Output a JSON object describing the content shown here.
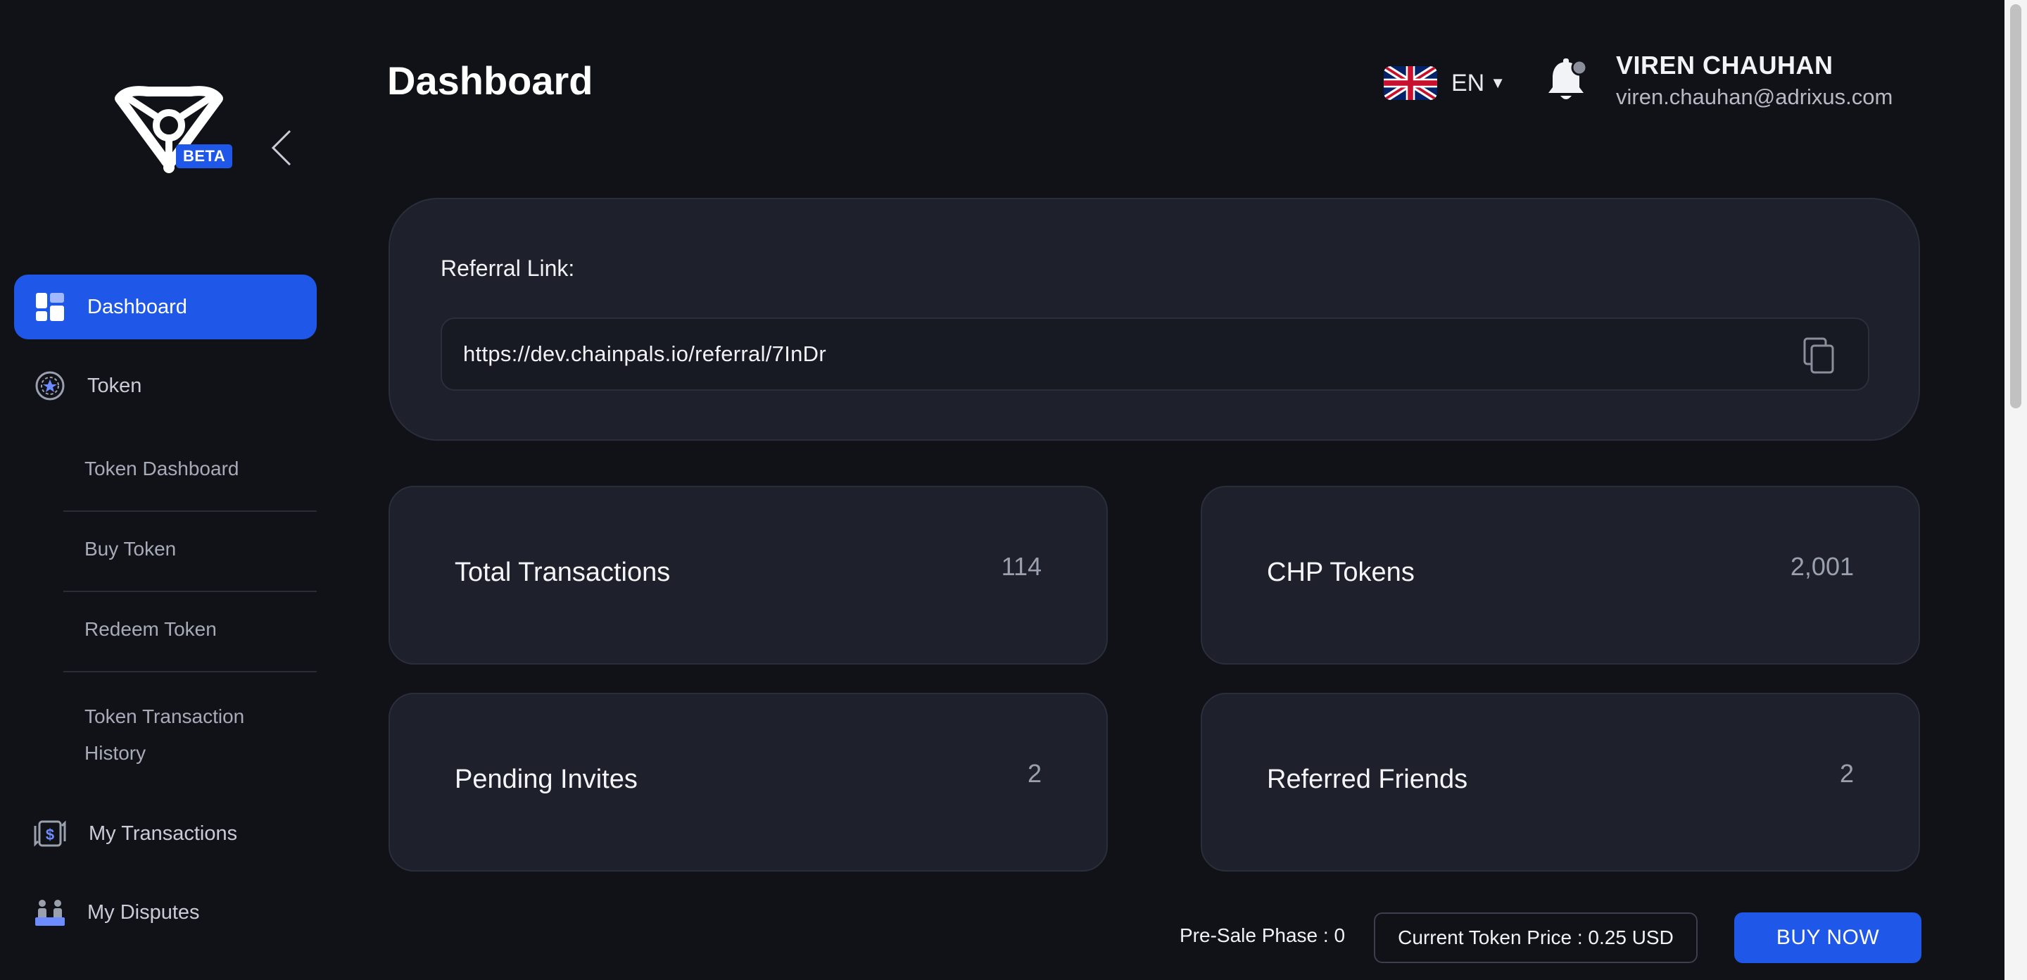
{
  "brand": {
    "badge": "BETA"
  },
  "header": {
    "title": "Dashboard",
    "language": "EN",
    "user_name": "VIREN CHAUHAN",
    "user_email": "viren.chauhan@adrixus.com"
  },
  "sidebar": {
    "items": [
      {
        "label": "Dashboard",
        "icon": "dashboard-icon",
        "active": true
      },
      {
        "label": "Token",
        "icon": "token-icon"
      },
      {
        "label": "My Transactions",
        "icon": "transactions-icon"
      },
      {
        "label": "My Disputes",
        "icon": "disputes-icon"
      }
    ],
    "token_subitems": [
      {
        "label": "Token Dashboard"
      },
      {
        "label": "Buy Token"
      },
      {
        "label": "Redeem Token"
      },
      {
        "label": "Token Transaction",
        "label2": "History"
      }
    ]
  },
  "referral": {
    "label": "Referral Link:",
    "url": "https://dev.chainpals.io/referral/7InDr"
  },
  "stats": [
    {
      "label": "Total Transactions",
      "value": "114"
    },
    {
      "label": "CHP Tokens",
      "value": "2,001"
    },
    {
      "label": "Pending Invites",
      "value": "2"
    },
    {
      "label": "Referred Friends",
      "value": "2"
    }
  ],
  "footer": {
    "presale": "Pre-Sale Phase : 0",
    "price": "Current Token Price : 0.25 USD",
    "buy_label": "BUY NOW"
  },
  "colors": {
    "accent": "#1f57e8",
    "background": "#101218",
    "card": "#1e212b"
  }
}
